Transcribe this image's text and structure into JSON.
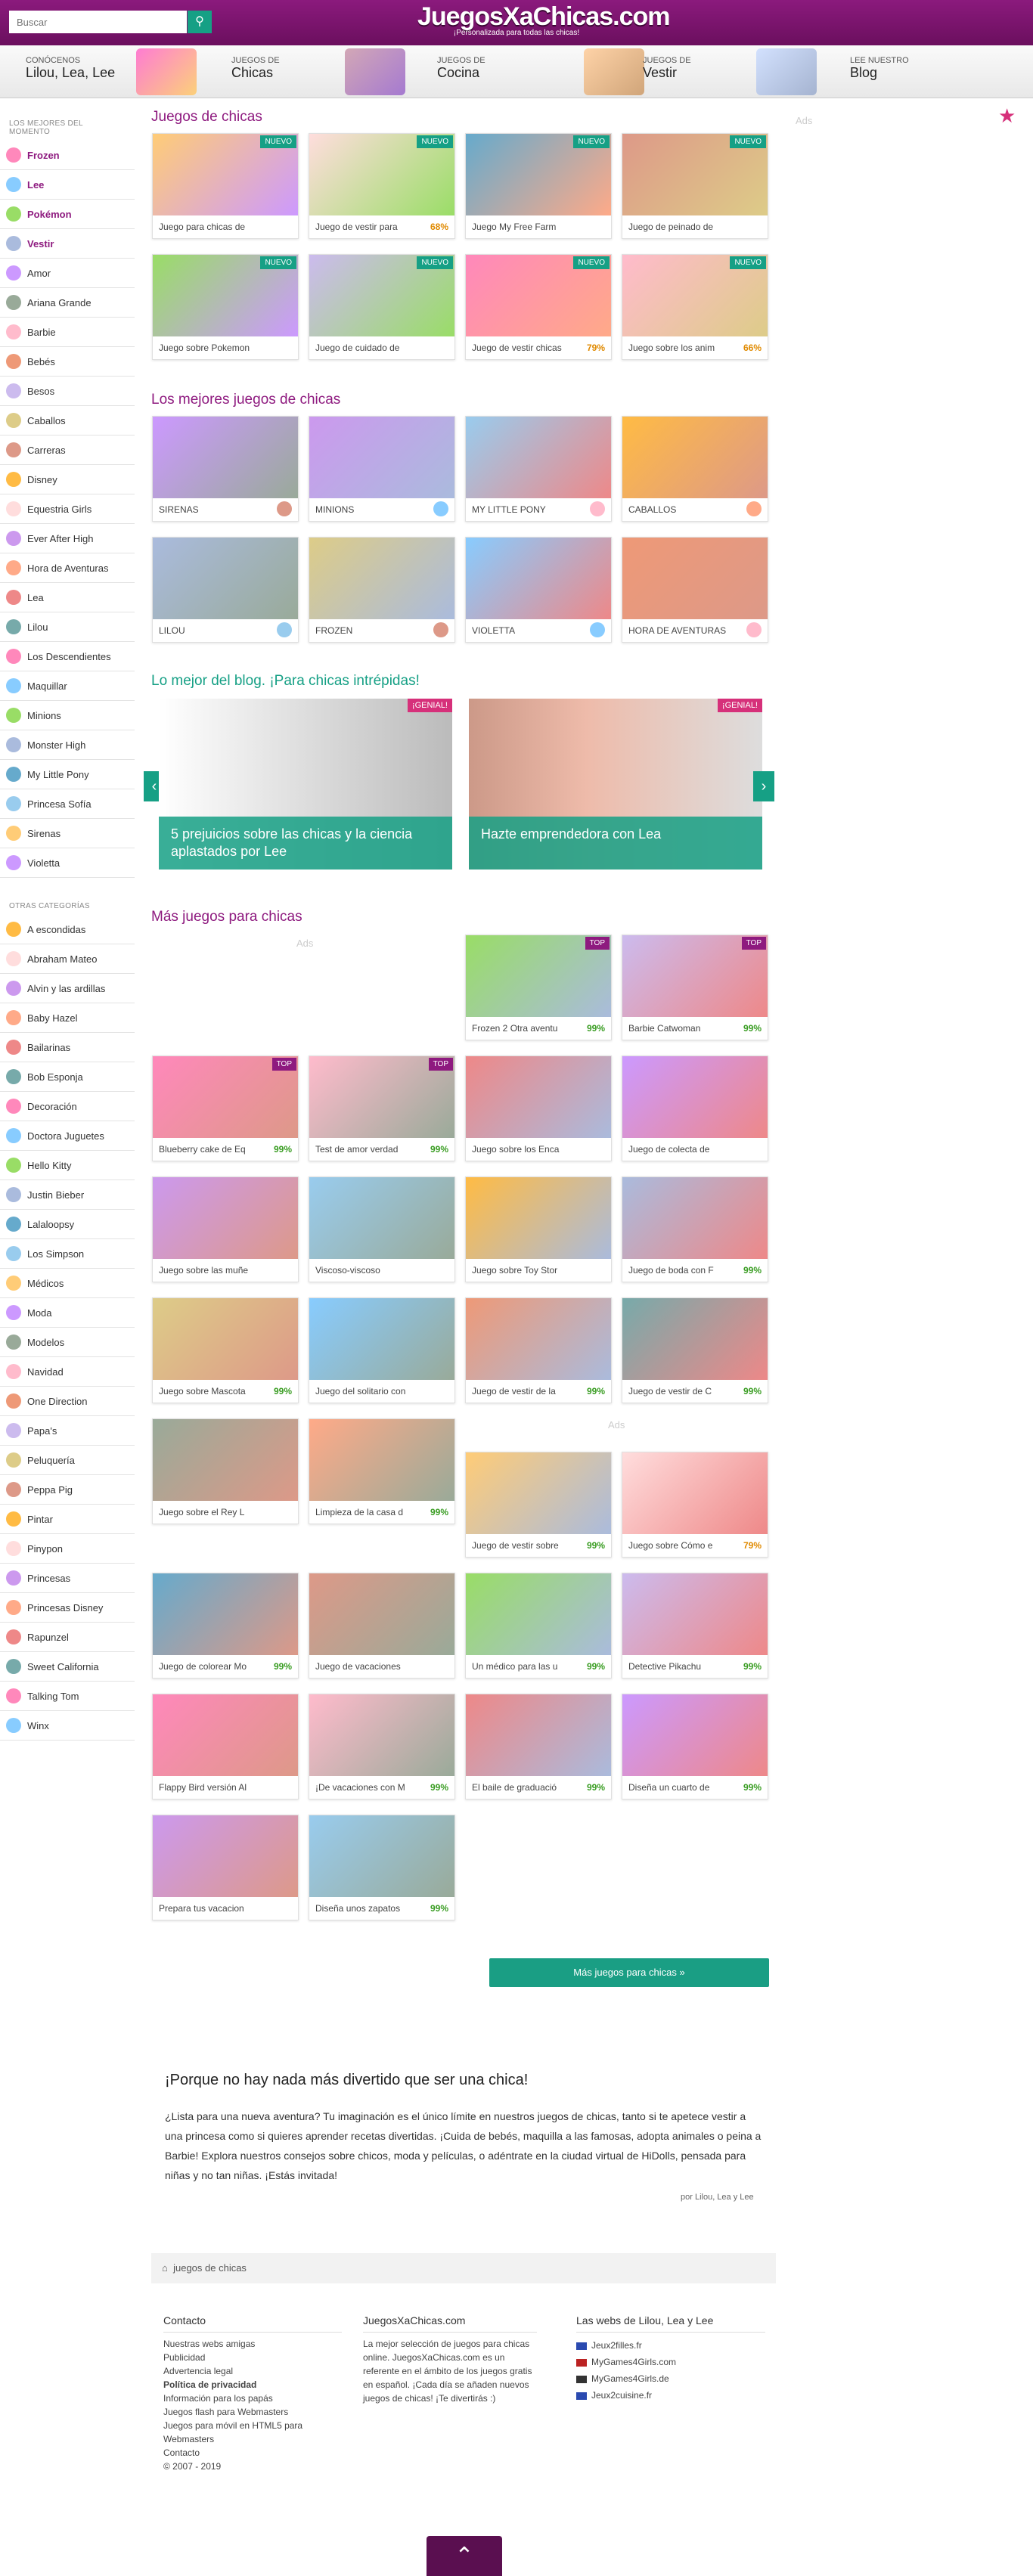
{
  "header": {
    "search_placeholder": "Buscar",
    "logo": "JuegosXaChicas.com",
    "logo_tagline": "¡Personalizada para todas las chicas!"
  },
  "nav": [
    {
      "small": "Conócenos",
      "big": "Lilou, Lea, Lee"
    },
    {
      "small": "Juegos de",
      "big": "Chicas"
    },
    {
      "small": "Juegos de",
      "big": "Cocina"
    },
    {
      "small": "Juegos de",
      "big": "Vestir"
    },
    {
      "small": "Lee nuestro",
      "big": "Blog"
    }
  ],
  "sidebar": {
    "top_header": "Los mejores del momento",
    "top": [
      "Frozen",
      "Lee",
      "Pokémon",
      "Vestir"
    ],
    "cats": [
      "Amor",
      "Ariana Grande",
      "Barbie",
      "Bebés",
      "Besos",
      "Caballos",
      "Carreras",
      "Disney",
      "Equestria Girls",
      "Ever After High",
      "Hora de Aventuras",
      "Lea",
      "Lilou",
      "Los Descendientes",
      "Maquillar",
      "Minions",
      "Monster High",
      "My Little Pony",
      "Princesa Sofía",
      "Sirenas",
      "Violetta"
    ],
    "other_header": "Otras categorías",
    "other": [
      "A escondidas",
      "Abraham Mateo",
      "Alvin y las ardillas",
      "Baby Hazel",
      "Bailarinas",
      "Bob Esponja",
      "Decoración",
      "Doctora Juguetes",
      "Hello Kitty",
      "Justin Bieber",
      "Lalaloopsy",
      "Los Simpson",
      "Médicos",
      "Moda",
      "Modelos",
      "Navidad",
      "One Direction",
      "Papa's",
      "Peluquería",
      "Peppa Pig",
      "Pintar",
      "Pinypon",
      "Princesas",
      "Princesas Disney",
      "Rapunzel",
      "Sweet California",
      "Talking Tom",
      "Winx"
    ]
  },
  "sections": {
    "s1": "Juegos de chicas",
    "s2": "Los mejores juegos de chicas",
    "s3": "Lo mejor del blog. ¡Para chicas intrépidas!",
    "s4": "Más juegos para chicas",
    "ads": "Ads"
  },
  "new_games": [
    {
      "caption": "Juego para chicas de",
      "pct": "",
      "badge": "NUEVO"
    },
    {
      "caption": "Juego de vestir para",
      "pct": "68%",
      "badge": "NUEVO"
    },
    {
      "caption": "Juego My Free Farm",
      "pct": "",
      "badge": "NUEVO"
    },
    {
      "caption": "Juego de peinado de",
      "pct": "",
      "badge": "NUEVO"
    },
    {
      "caption": "Juego sobre Pokemon",
      "pct": "",
      "badge": "NUEVO"
    },
    {
      "caption": "Juego de cuidado de",
      "pct": "",
      "badge": "NUEVO"
    },
    {
      "caption": "Juego de vestir chicas",
      "pct": "79%",
      "badge": "NUEVO"
    },
    {
      "caption": "Juego sobre los anim",
      "pct": "66%",
      "badge": "NUEVO"
    }
  ],
  "best": [
    "SIRENAS",
    "MINIONS",
    "MY LITTLE PONY",
    "CABALLOS",
    "LILOU",
    "FROZEN",
    "VIOLETTA",
    "HORA DE AVENTURAS"
  ],
  "blog": [
    {
      "title": "5 prejuicios sobre las chicas y la ciencia aplastados por Lee",
      "badge": "¡GENIAL!"
    },
    {
      "title": "Hazte emprendedora con Lea",
      "badge": "¡GENIAL!"
    }
  ],
  "more_games": [
    {
      "caption": "Frozen 2 Otra aventu",
      "pct": "99%",
      "badge": "TOP"
    },
    {
      "caption": "Barbie Catwoman",
      "pct": "99%",
      "badge": "TOP"
    },
    {
      "caption": "Blueberry cake de Eq",
      "pct": "99%",
      "badge": "TOP"
    },
    {
      "caption": "Test de amor verdad",
      "pct": "99%",
      "badge": "TOP"
    },
    {
      "caption": "Juego sobre los Enca",
      "pct": "",
      "badge": ""
    },
    {
      "caption": "Juego de colecta de",
      "pct": "",
      "badge": ""
    },
    {
      "caption": "Juego sobre las muñe",
      "pct": "",
      "badge": ""
    },
    {
      "caption": "Viscoso-viscoso",
      "pct": "",
      "badge": ""
    },
    {
      "caption": "Juego sobre Toy Stor",
      "pct": "",
      "badge": ""
    },
    {
      "caption": "Juego de boda con F",
      "pct": "99%",
      "badge": ""
    },
    {
      "caption": "Juego sobre Mascota",
      "pct": "99%",
      "badge": ""
    },
    {
      "caption": "Juego del solitario con",
      "pct": "",
      "badge": ""
    },
    {
      "caption": "Juego de vestir de la",
      "pct": "99%",
      "badge": ""
    },
    {
      "caption": "Juego de vestir de C",
      "pct": "99%",
      "badge": ""
    },
    {
      "caption": "Juego sobre el Rey L",
      "pct": "",
      "badge": ""
    },
    {
      "caption": "Limpieza de la casa d",
      "pct": "99%",
      "badge": ""
    },
    {
      "caption": "Juego de vestir sobre",
      "pct": "99%",
      "badge": ""
    },
    {
      "caption": "Juego sobre Cómo e",
      "pct": "79%",
      "badge": ""
    },
    {
      "caption": "Juego de colorear Mo",
      "pct": "99%",
      "badge": ""
    },
    {
      "caption": "Juego de vacaciones",
      "pct": "",
      "badge": ""
    },
    {
      "caption": "Un médico para las u",
      "pct": "99%",
      "badge": ""
    },
    {
      "caption": "Detective Pikachu",
      "pct": "99%",
      "badge": ""
    },
    {
      "caption": "Flappy Bird versión Al",
      "pct": "",
      "badge": ""
    },
    {
      "caption": "¡De vacaciones con M",
      "pct": "99%",
      "badge": ""
    },
    {
      "caption": "El baile de graduació",
      "pct": "99%",
      "badge": ""
    },
    {
      "caption": "Diseña un cuarto de",
      "pct": "99%",
      "badge": ""
    },
    {
      "caption": "Prepara tus vacacion",
      "pct": "",
      "badge": ""
    },
    {
      "caption": "Diseña unos zapatos",
      "pct": "99%",
      "badge": ""
    }
  ],
  "more_button": "Más juegos para chicas »",
  "about": {
    "title": "¡Porque no hay nada más divertido que ser una chica!",
    "text": "¿Lista para una nueva aventura? Tu imaginación es el único límite en nuestros juegos de chicas, tanto si te apetece vestir a una princesa como si quieres aprender recetas divertidas. ¡Cuida de bebés, maquilla a las famosas, adopta animales o peina a Barbie! Explora nuestros consejos sobre chicos, moda y películas, o adéntrate en la ciudad virtual de HiDolls, pensada para niñas y no tan niñas. ¡Estás invitada!",
    "by": "por Lilou, Lea y Lee"
  },
  "breadcrumb": "juegos de chicas",
  "footer": {
    "c1_title": "Contacto",
    "c1_links": [
      "Nuestras webs amigas",
      "Publicidad",
      "Advertencia legal",
      "Política de privacidad",
      "Información para los papás",
      "Juegos flash para Webmasters",
      "Juegos para móvil en HTML5 para Webmasters",
      "Contacto",
      "© 2007 - 2019"
    ],
    "c2_title": "JuegosXaChicas.com",
    "c2_text": "La mejor selección de juegos para chicas online. JuegosXaChicas.com es un referente en el ámbito de los juegos gratis en español. ¡Cada día se añaden nuevos juegos de chicas! ¡Te divertirás :)",
    "c3_title": "Las webs de Lilou, Lea y Lee",
    "c3_sites": [
      "Jeux2filles.fr",
      "MyGames4Girls.com",
      "MyGames4Girls.de",
      "Jeux2cuisine.fr"
    ]
  },
  "colors": {
    "brand": "#8e1a7f",
    "accent": "#16a085",
    "pink": "#d6307a"
  }
}
